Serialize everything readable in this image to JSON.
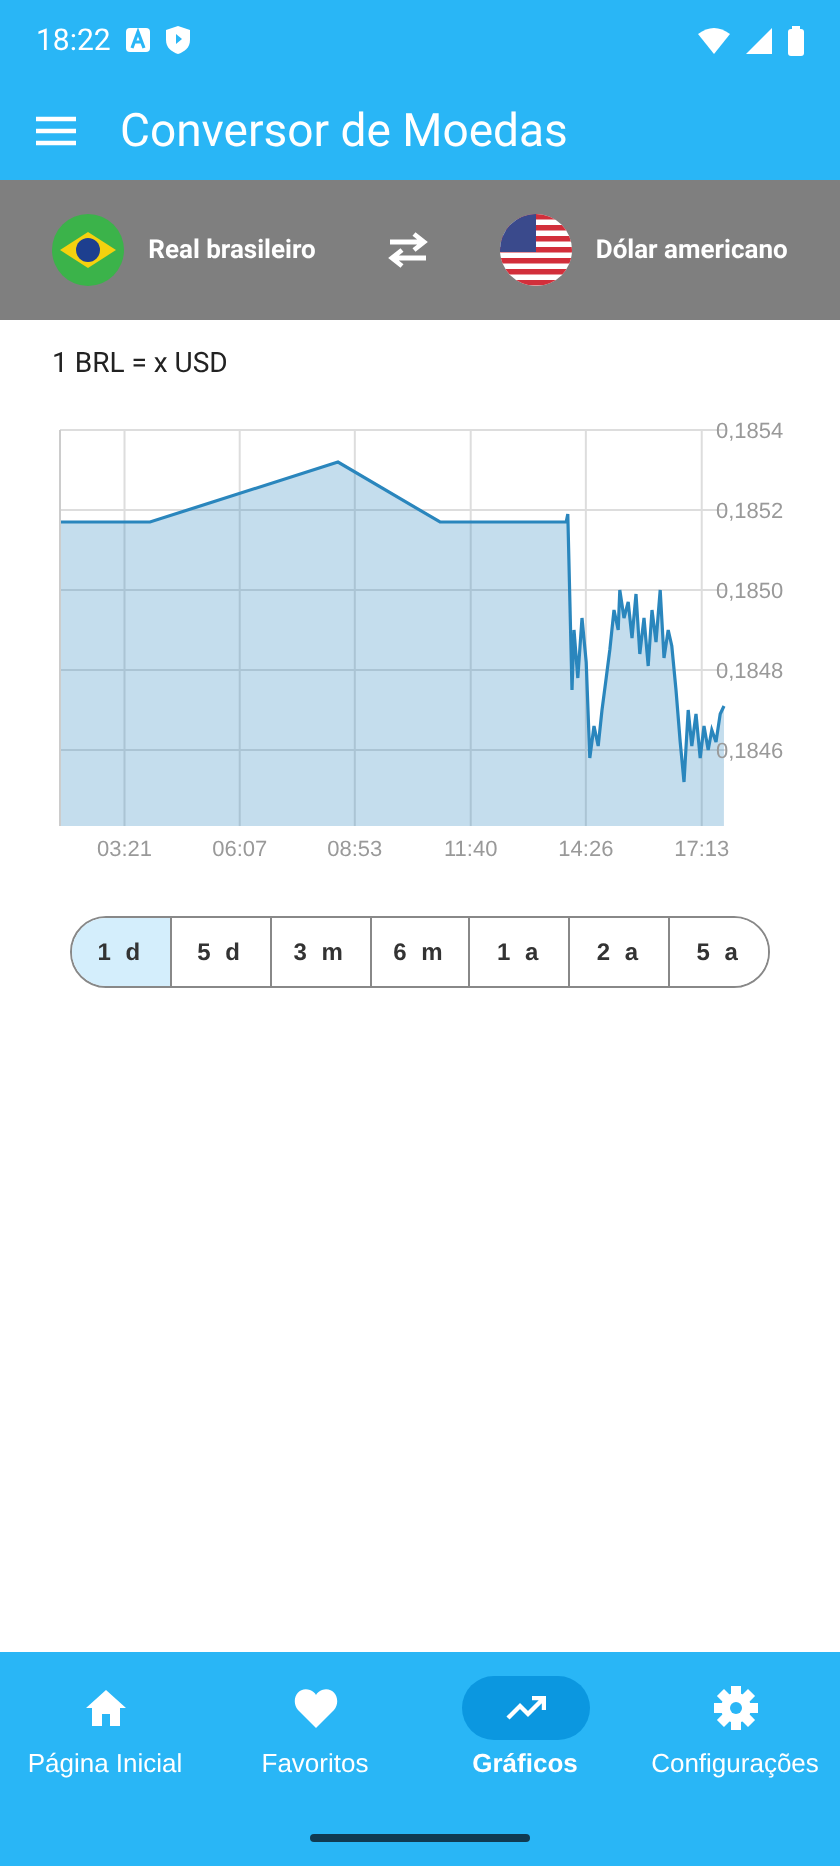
{
  "status_bar": {
    "time": "18:22"
  },
  "app_bar": {
    "title": "Conversor de Moedas"
  },
  "currency_bar": {
    "from": "Real brasileiro",
    "to": "Dólar americano"
  },
  "rate_label": "1 BRL = x USD",
  "chart_data": {
    "type": "area",
    "x": [
      1.8,
      3.96,
      8.48,
      10.93,
      13.96,
      14.0,
      14.1,
      14.15,
      14.24,
      14.34,
      14.44,
      14.53,
      14.63,
      14.73,
      14.82,
      14.92,
      15.01,
      15.11,
      15.21,
      15.25,
      15.35,
      15.45,
      15.54,
      15.64,
      15.73,
      15.83,
      15.93,
      16.02,
      16.12,
      16.22,
      16.31,
      16.41,
      16.5,
      16.6,
      16.7,
      16.79,
      16.89,
      16.98,
      17.08,
      17.18,
      17.27,
      17.37,
      17.46,
      17.56,
      17.66,
      17.75
    ],
    "grid": true,
    "series": [
      {
        "color": "#2a86bd",
        "values": [
          0.18517,
          0.18517,
          0.18532,
          0.18517,
          0.18517,
          0.18519,
          0.18475,
          0.1849,
          0.18478,
          0.18493,
          0.18482,
          0.18458,
          0.18466,
          0.18461,
          0.1847,
          0.18478,
          0.18485,
          0.18495,
          0.1849,
          0.185,
          0.18493,
          0.18497,
          0.18488,
          0.18499,
          0.18484,
          0.18493,
          0.18481,
          0.18495,
          0.18487,
          0.185,
          0.18483,
          0.1849,
          0.18486,
          0.18475,
          0.18462,
          0.18452,
          0.1847,
          0.18461,
          0.18469,
          0.18458,
          0.18466,
          0.1846,
          0.18465,
          0.18462,
          0.18469,
          0.18471
        ]
      }
    ],
    "xlim": [
      1.8,
      17.8
    ],
    "ylim": [
      0.18441,
      0.1854
    ],
    "xticks": [
      {
        "value": 3.35,
        "label": "03:21"
      },
      {
        "value": 6.117,
        "label": "06:07"
      },
      {
        "value": 8.883,
        "label": "08:53"
      },
      {
        "value": 11.667,
        "label": "11:40"
      },
      {
        "value": 14.433,
        "label": "14:26"
      },
      {
        "value": 17.217,
        "label": "17:13"
      }
    ],
    "yticks": [
      {
        "value": 0.1854,
        "label": "0,1854"
      },
      {
        "value": 0.1852,
        "label": "0,1852"
      },
      {
        "value": 0.185,
        "label": "0,1850"
      },
      {
        "value": 0.1848,
        "label": "0,1848"
      },
      {
        "value": 0.1846,
        "label": "0,1846"
      }
    ]
  },
  "ranges": [
    {
      "label": "1 d",
      "selected": true
    },
    {
      "label": "5 d",
      "selected": false
    },
    {
      "label": "3 m",
      "selected": false
    },
    {
      "label": "6 m",
      "selected": false
    },
    {
      "label": "1 a",
      "selected": false
    },
    {
      "label": "2 a",
      "selected": false
    },
    {
      "label": "5 a",
      "selected": false
    }
  ],
  "bottom_nav": [
    {
      "kind": "home",
      "label": "Página Inicial",
      "selected": false
    },
    {
      "kind": "favorites",
      "label": "Favoritos",
      "selected": false
    },
    {
      "kind": "charts",
      "label": "Gráficos",
      "selected": true
    },
    {
      "kind": "settings",
      "label": "Configurações",
      "selected": false
    }
  ]
}
